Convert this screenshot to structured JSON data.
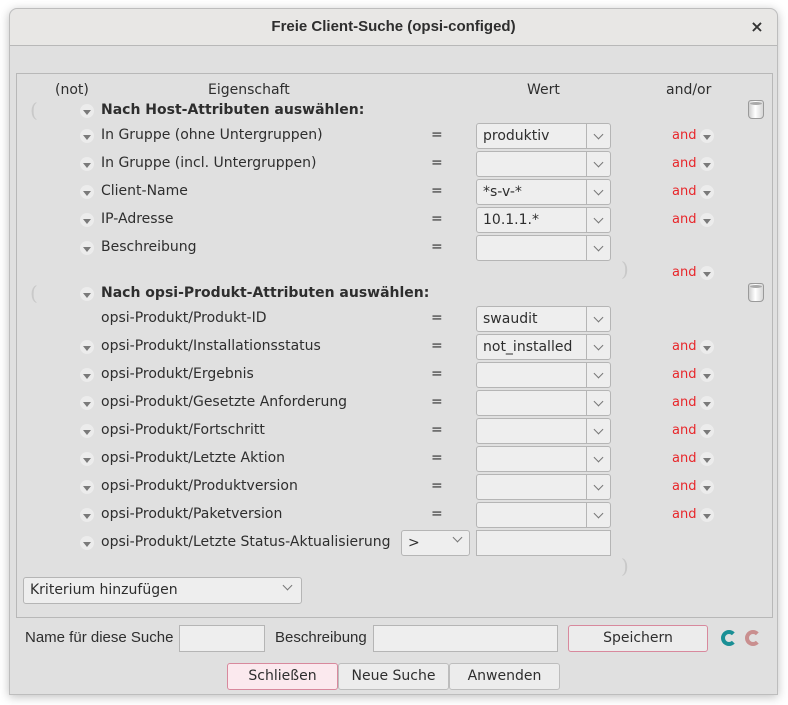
{
  "window": {
    "title": "Freie Client-Suche (opsi-configed)",
    "close_label": "×"
  },
  "headers": {
    "not": "(not)",
    "property": "Eigenschaft",
    "value": "Wert",
    "andor": "and/or"
  },
  "groups": [
    {
      "title": "Nach Host-Attributen auswählen:",
      "rows": [
        {
          "property": "In Gruppe (ohne Untergruppen)",
          "operator": "=",
          "value": "produktiv",
          "andor": "and"
        },
        {
          "property": "In Gruppe (incl. Untergruppen)",
          "operator": "=",
          "value": "",
          "andor": "and"
        },
        {
          "property": "Client-Name",
          "operator": "=",
          "value": "*s-v-*",
          "andor": "and"
        },
        {
          "property": "IP-Adresse",
          "operator": "=",
          "value": "10.1.1.*",
          "andor": "and"
        },
        {
          "property": "Beschreibung",
          "operator": "=",
          "value": "",
          "andor": ""
        }
      ],
      "group_andor": "and"
    },
    {
      "title": "Nach opsi-Produkt-Attributen auswählen:",
      "rows": [
        {
          "property": "opsi-Produkt/Produkt-ID",
          "operator": "=",
          "value": "swaudit",
          "andor": ""
        },
        {
          "property": "opsi-Produkt/Installationsstatus",
          "operator": "=",
          "value": "not_installed",
          "andor": "and"
        },
        {
          "property": "opsi-Produkt/Ergebnis",
          "operator": "=",
          "value": "",
          "andor": "and"
        },
        {
          "property": "opsi-Produkt/Gesetzte Anforderung",
          "operator": "=",
          "value": "",
          "andor": "and"
        },
        {
          "property": "opsi-Produkt/Fortschritt",
          "operator": "=",
          "value": "",
          "andor": "and"
        },
        {
          "property": "opsi-Produkt/Letzte Aktion",
          "operator": "=",
          "value": "",
          "andor": "and"
        },
        {
          "property": "opsi-Produkt/Produktversion",
          "operator": "=",
          "value": "",
          "andor": "and"
        },
        {
          "property": "opsi-Produkt/Paketversion",
          "operator": "=",
          "value": "",
          "andor": "and"
        },
        {
          "property": "opsi-Produkt/Letzte Status-Aktualisierung",
          "operator": ">",
          "value": "",
          "andor": ""
        }
      ]
    }
  ],
  "add_criterion": {
    "label": "Kriterium hinzufügen"
  },
  "footer": {
    "name_label": "Name für diese Suche",
    "name_value": "",
    "description_label": "Beschreibung",
    "description_value": "",
    "save_label": "Speichern",
    "close_label": "Schließen",
    "new_search_label": "Neue Suche",
    "apply_label": "Anwenden"
  },
  "icons": {
    "reload_active_color": "#1a8f95",
    "reload_inactive_color": "#c98f8f"
  },
  "colors": {
    "andor": "#e8262a",
    "accent_pink": "#d8899d"
  }
}
